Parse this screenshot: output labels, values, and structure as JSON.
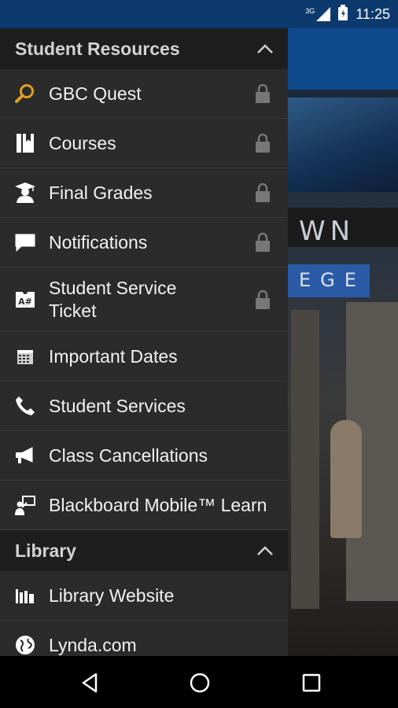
{
  "status": {
    "network": "3G",
    "time": "11:25"
  },
  "colors": {
    "accent": "#e0a020",
    "drawer_bg": "#2b2b2b",
    "header_bg": "#1e1e1e",
    "app_bar": "#0e4a8c"
  },
  "background": {
    "sign_text": "WN",
    "college_text": "EGE"
  },
  "drawer": {
    "sections": [
      {
        "title": "Student Resources",
        "items": [
          {
            "label": "GBC Quest",
            "icon": "search-icon",
            "locked": true
          },
          {
            "label": "Courses",
            "icon": "book-icon",
            "locked": true
          },
          {
            "label": "Final Grades",
            "icon": "graduate-icon",
            "locked": true
          },
          {
            "label": "Notifications",
            "icon": "chat-bubble-icon",
            "locked": true
          },
          {
            "label": "Student Service Ticket",
            "icon": "ticket-icon",
            "locked": true
          },
          {
            "label": "Important Dates",
            "icon": "calendar-icon",
            "locked": false
          },
          {
            "label": "Student Services",
            "icon": "phone-icon",
            "locked": false
          },
          {
            "label": "Class Cancellations",
            "icon": "megaphone-icon",
            "locked": false
          },
          {
            "label": "Blackboard Mobile™ Learn",
            "icon": "blackboard-icon",
            "locked": false
          }
        ]
      },
      {
        "title": "Library",
        "items": [
          {
            "label": "Library Website",
            "icon": "library-books-icon",
            "locked": false
          },
          {
            "label": "Lynda.com",
            "icon": "globe-icon",
            "locked": false
          }
        ]
      }
    ]
  }
}
